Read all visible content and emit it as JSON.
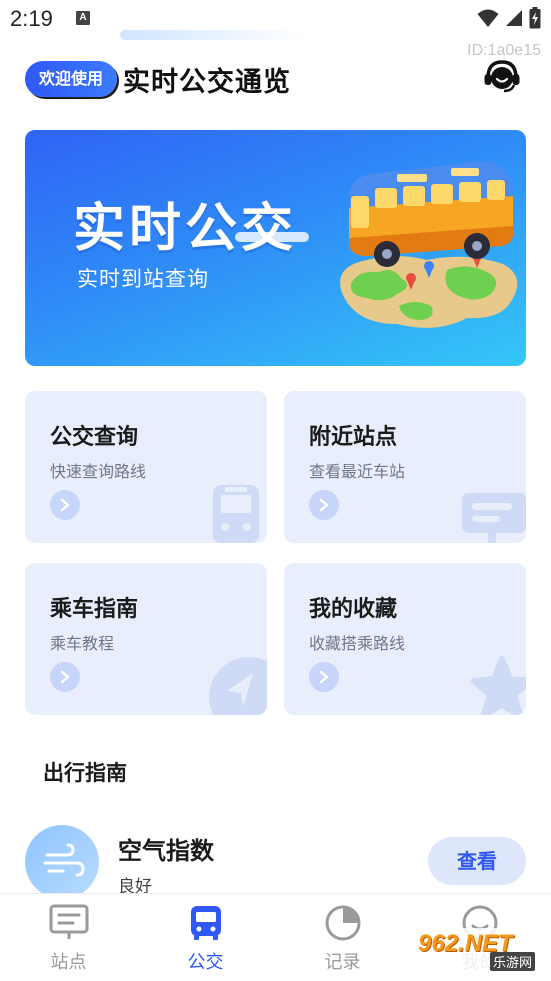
{
  "status_bar": {
    "time": "2:19",
    "notification_letter": "A",
    "icons": [
      "wifi-icon",
      "signal-icon",
      "battery-charging-icon"
    ]
  },
  "header": {
    "welcome_pill": "欢迎使用",
    "app_title": "实时公交通览",
    "device_id": "ID:1a0e15",
    "support_icon": "headset-icon"
  },
  "banner": {
    "title": "实时公交",
    "subtitle": "实时到站查询",
    "art": "bus-on-map-illustration"
  },
  "cards": [
    {
      "title": "公交查询",
      "subtitle": "快速查询路线",
      "icon": "bus-icon"
    },
    {
      "title": "附近站点",
      "subtitle": "查看最近车站",
      "icon": "bus-stop-sign-icon"
    },
    {
      "title": "乘车指南",
      "subtitle": "乘车教程",
      "icon": "navigation-arrow-icon"
    },
    {
      "title": "我的收藏",
      "subtitle": "收藏搭乘路线",
      "icon": "star-icon"
    }
  ],
  "guide": {
    "section_title": "出行指南",
    "item": {
      "title": "空气指数",
      "status": "良好",
      "button": "查看",
      "icon": "wind-icon"
    }
  },
  "tabbar": {
    "active_index": 1,
    "active_color": "#2f58f4",
    "tabs": [
      {
        "label": "站点",
        "icon": "stop-board-icon"
      },
      {
        "label": "公交",
        "icon": "bus-icon"
      },
      {
        "label": "记录",
        "icon": "history-icon"
      },
      {
        "label": "我的",
        "icon": "profile-icon"
      }
    ]
  },
  "watermark": {
    "main": "962.NET",
    "sub": "乐游网"
  },
  "colors": {
    "primary": "#2f58f4",
    "card_bg": "#e9eefc",
    "banner_start": "#2f63f5",
    "banner_end": "#34c7f7"
  }
}
